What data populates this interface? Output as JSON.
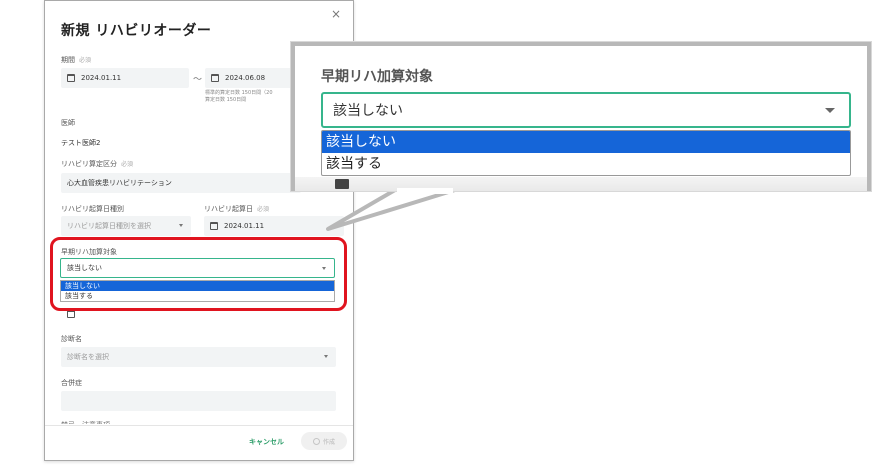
{
  "modal": {
    "title": "新規 リハビリオーダー",
    "close_label": "×",
    "period": {
      "label": "期間",
      "required": "必須",
      "start": "2024.01.11",
      "separator": "～",
      "end": "2024.06.08",
      "note_line1": "標準的算定日数 150日間（20",
      "note_line2": "算定日数 150日間"
    },
    "doctor": {
      "label": "医師",
      "value": "テスト医師2"
    },
    "rehab_category": {
      "label": "リハビリ算定区分",
      "required": "必須",
      "value": "心大血管疾患リハビリテーション"
    },
    "start_type": {
      "label": "リハビリ起算日種別",
      "placeholder": "リハビリ起算日種別を選択"
    },
    "start_date": {
      "label": "リハビリ起算日",
      "required": "必須",
      "value": "2024.01.11"
    },
    "early_rehab": {
      "label": "早期リハ加算対象",
      "selected": "該当しない",
      "options": [
        "該当しない",
        "該当する"
      ]
    },
    "diagnosis": {
      "label": "診断名",
      "placeholder": "診断名を選択"
    },
    "complication": {
      "label": "合併症",
      "value": ""
    },
    "cut_label": "禁忌・注意事項",
    "footer": {
      "cancel": "キャンセル",
      "create": "作成"
    }
  },
  "callout": {
    "title": "早期リハ加算対象",
    "selected": "該当しない",
    "options": [
      "該当しない",
      "該当する"
    ]
  },
  "colors": {
    "accent_green": "#36b58c",
    "selected_blue": "#1565d8",
    "highlight_red": "#e0141f"
  }
}
